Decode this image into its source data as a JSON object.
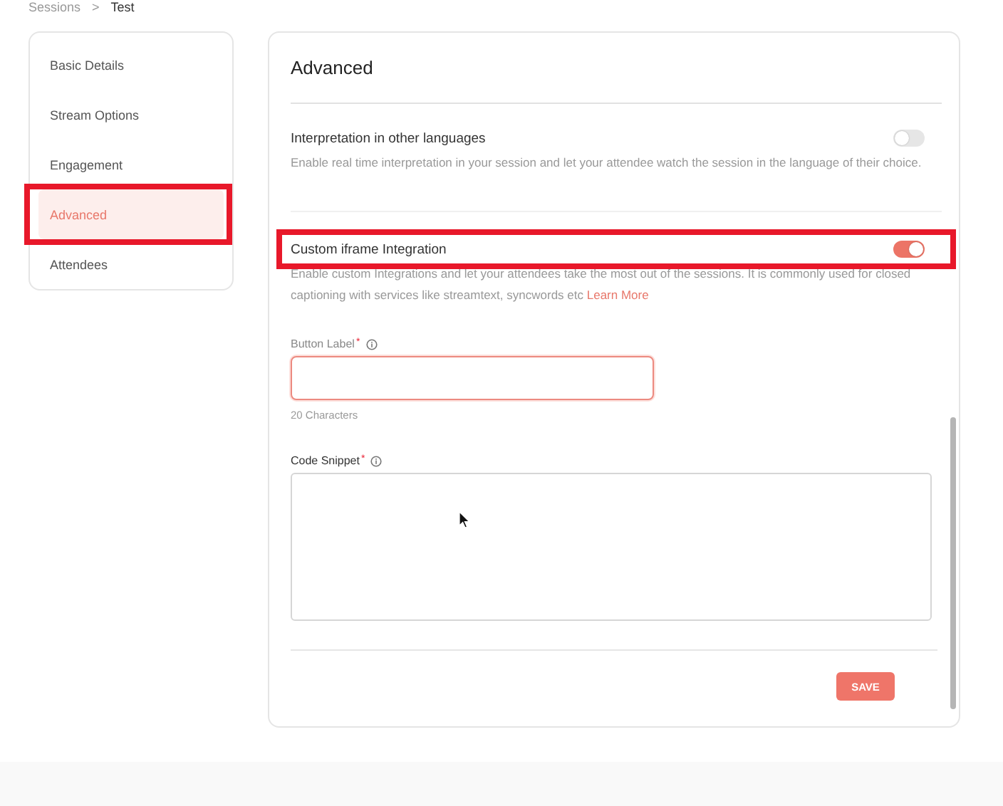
{
  "breadcrumb": {
    "parent": "Sessions",
    "separator": ">",
    "current": "Test"
  },
  "sidebar": {
    "items": [
      {
        "label": "Basic Details",
        "selected": false,
        "highlighted": false
      },
      {
        "label": "Stream Options",
        "selected": false,
        "highlighted": false
      },
      {
        "label": "Engagement",
        "selected": false,
        "highlighted": false
      },
      {
        "label": "Advanced",
        "selected": true,
        "highlighted": true
      },
      {
        "label": "Attendees",
        "selected": false,
        "highlighted": false
      }
    ]
  },
  "panel": {
    "title": "Advanced",
    "settings": [
      {
        "title": "Interpretation in other languages",
        "description": "Enable real time interpretation in your session and let your attendee watch the session in the language of their choice.",
        "on": false
      },
      {
        "title": "Custom iframe Integration",
        "description": "Enable custom Integrations and let your attendees take the most out of the sessions. It is commonly used for closed captioning with services like streamtext, syncwords etc",
        "link": "Learn More",
        "on": true,
        "highlighted": true
      }
    ],
    "button_label": {
      "label": "Button Label",
      "required": "*",
      "hint": "20 Characters"
    },
    "code_snippet": {
      "label": "Code Snippet",
      "required": "*"
    },
    "save": "SAVE"
  }
}
